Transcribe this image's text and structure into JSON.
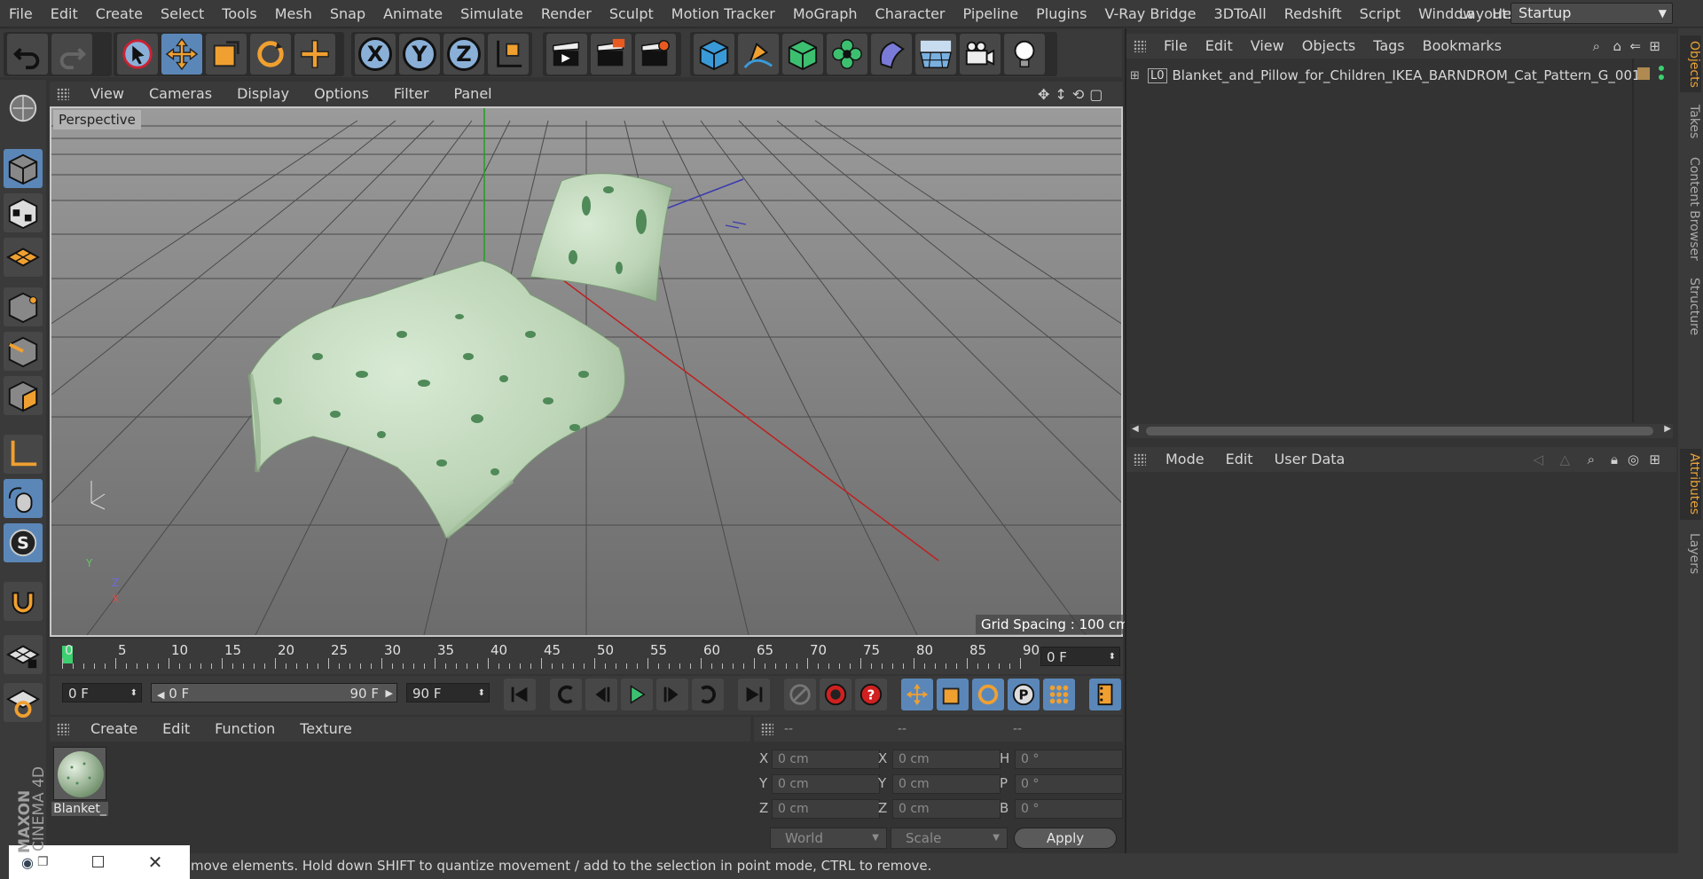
{
  "menubar": {
    "items": [
      "File",
      "Edit",
      "Create",
      "Select",
      "Tools",
      "Mesh",
      "Snap",
      "Animate",
      "Simulate",
      "Render",
      "Sculpt",
      "Motion Tracker",
      "MoGraph",
      "Character",
      "Pipeline",
      "Plugins",
      "V-Ray Bridge",
      "3DToAll",
      "Redshift",
      "Script",
      "Window",
      "Help"
    ],
    "layout_label": "Layout:",
    "layout_value": "Startup"
  },
  "viewport": {
    "menu": [
      "View",
      "Cameras",
      "Display",
      "Options",
      "Filter",
      "Panel"
    ],
    "label": "Perspective",
    "grid_spacing": "Grid Spacing : 100 cm",
    "axis_x": "X",
    "axis_y": "Y",
    "axis_z": "Z"
  },
  "timeline": {
    "ticks": [
      "0",
      "5",
      "10",
      "15",
      "20",
      "25",
      "30",
      "35",
      "40",
      "45",
      "50",
      "55",
      "60",
      "65",
      "70",
      "75",
      "80",
      "85",
      "90"
    ],
    "current_frame": "0 F",
    "start_field": "0 F",
    "range_start": "0 F",
    "range_end": "90 F",
    "end_field": "90 F"
  },
  "material": {
    "menu": [
      "Create",
      "Edit",
      "Function",
      "Texture"
    ],
    "name": "Blanket_"
  },
  "coordinates": {
    "headers": [
      "--",
      "--",
      "--"
    ],
    "pos": {
      "x": "0 cm",
      "y": "0 cm",
      "z": "0 cm"
    },
    "size": {
      "x": "0 cm",
      "y": "0 cm",
      "z": "0 cm"
    },
    "rot": {
      "h": "0 °",
      "p": "0 °",
      "b": "0 °"
    },
    "labels": {
      "x": "X",
      "y": "Y",
      "z": "Z",
      "h": "H",
      "p": "P",
      "b": "B"
    },
    "world": "World",
    "scale": "Scale",
    "apply": "Apply"
  },
  "objects": {
    "menu": [
      "File",
      "Edit",
      "View",
      "Objects",
      "Tags",
      "Bookmarks"
    ],
    "item": "Blanket_and_Pillow_for_Children_IKEA_BARNDROM_Cat_Pattern_G_001"
  },
  "attributes": {
    "menu": [
      "Mode",
      "Edit",
      "User Data"
    ]
  },
  "side_tabs": [
    "Objects",
    "Takes",
    "Content Browser",
    "Structure",
    "Attributes",
    "Layers"
  ],
  "status": {
    "text": "move elements. Hold down SHIFT to quantize movement / add to the selection in point mode, CTRL to remove."
  },
  "brand": {
    "line1": "MAXON",
    "line2": "CINEMA 4D"
  },
  "colors": {
    "accent_orange": "#e8a23a",
    "active_blue": "#5b87b8",
    "fabric": "#c6dcc0",
    "pattern": "#4f8a58"
  }
}
